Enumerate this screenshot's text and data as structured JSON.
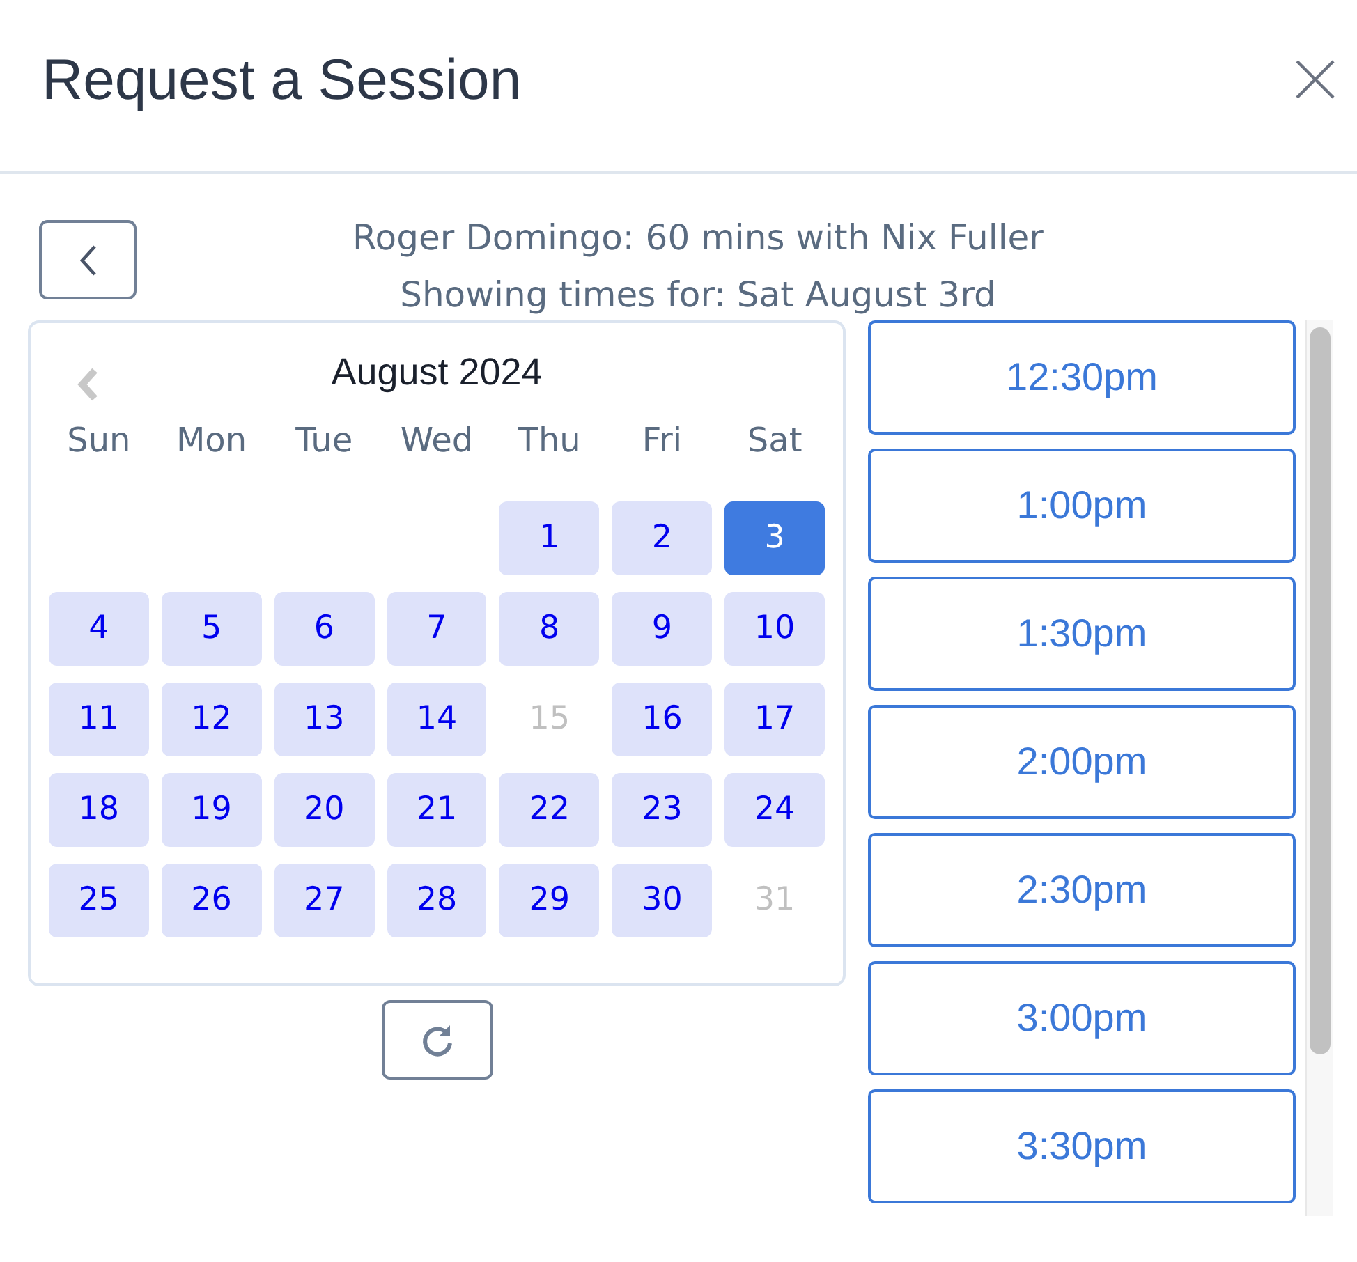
{
  "dialog": {
    "title": "Request a Session"
  },
  "summary": [
    "Roger Domingo: 60 mins with Nix Fuller",
    "Showing times for: Sat August 3rd"
  ],
  "calendar": {
    "month": "August 2024",
    "weekdays": [
      "Sun",
      "Mon",
      "Tue",
      "Wed",
      "Thu",
      "Fri",
      "Sat"
    ],
    "days": [
      {
        "day": "1",
        "available": true,
        "selected": false
      },
      {
        "day": "2",
        "available": true,
        "selected": false
      },
      {
        "day": "3",
        "available": true,
        "selected": true
      },
      {
        "day": "4",
        "available": true,
        "selected": false
      },
      {
        "day": "5",
        "available": true,
        "selected": false
      },
      {
        "day": "6",
        "available": true,
        "selected": false
      },
      {
        "day": "7",
        "available": true,
        "selected": false
      },
      {
        "day": "8",
        "available": true,
        "selected": false
      },
      {
        "day": "9",
        "available": true,
        "selected": false
      },
      {
        "day": "10",
        "available": true,
        "selected": false
      },
      {
        "day": "11",
        "available": true,
        "selected": false
      },
      {
        "day": "12",
        "available": true,
        "selected": false
      },
      {
        "day": "13",
        "available": true,
        "selected": false
      },
      {
        "day": "14",
        "available": true,
        "selected": false
      },
      {
        "day": "15",
        "available": false,
        "selected": false
      },
      {
        "day": "16",
        "available": true,
        "selected": false
      },
      {
        "day": "17",
        "available": true,
        "selected": false
      },
      {
        "day": "18",
        "available": true,
        "selected": false
      },
      {
        "day": "19",
        "available": true,
        "selected": false
      },
      {
        "day": "20",
        "available": true,
        "selected": false
      },
      {
        "day": "21",
        "available": true,
        "selected": false
      },
      {
        "day": "22",
        "available": true,
        "selected": false
      },
      {
        "day": "23",
        "available": true,
        "selected": false
      },
      {
        "day": "24",
        "available": true,
        "selected": false
      },
      {
        "day": "25",
        "available": true,
        "selected": false
      },
      {
        "day": "26",
        "available": true,
        "selected": false
      },
      {
        "day": "27",
        "available": true,
        "selected": false
      },
      {
        "day": "28",
        "available": true,
        "selected": false
      },
      {
        "day": "29",
        "available": true,
        "selected": false
      },
      {
        "day": "30",
        "available": true,
        "selected": false
      },
      {
        "day": "31",
        "available": false,
        "selected": false
      }
    ]
  },
  "time_slots": [
    "12:30pm",
    "1:00pm",
    "1:30pm",
    "2:00pm",
    "2:30pm",
    "3:00pm",
    "3:30pm"
  ]
}
